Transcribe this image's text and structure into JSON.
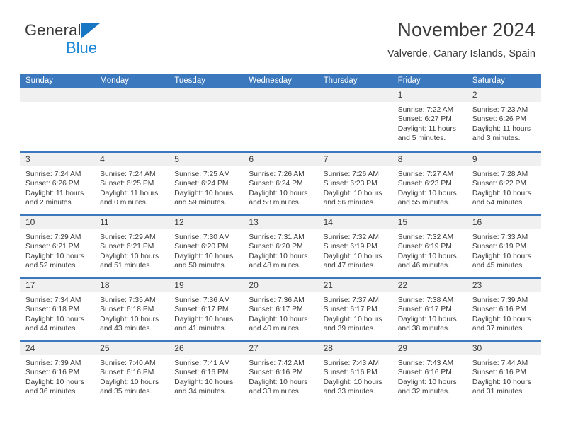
{
  "logo": {
    "word1": "General",
    "word2": "Blue",
    "triangle_icon": "triangle-icon"
  },
  "header": {
    "title": "November 2024",
    "subtitle": "Valverde, Canary Islands, Spain"
  },
  "colors": {
    "header_blue": "#3b78bd",
    "logo_blue": "#1d87d6",
    "daynum_band": "#f0f0f0",
    "text": "#3a3a3a"
  },
  "calendar": {
    "weekdays": [
      "Sunday",
      "Monday",
      "Tuesday",
      "Wednesday",
      "Thursday",
      "Friday",
      "Saturday"
    ],
    "weeks": [
      [
        {
          "day": "",
          "sunrise": "",
          "sunset": "",
          "daylight": ""
        },
        {
          "day": "",
          "sunrise": "",
          "sunset": "",
          "daylight": ""
        },
        {
          "day": "",
          "sunrise": "",
          "sunset": "",
          "daylight": ""
        },
        {
          "day": "",
          "sunrise": "",
          "sunset": "",
          "daylight": ""
        },
        {
          "day": "",
          "sunrise": "",
          "sunset": "",
          "daylight": ""
        },
        {
          "day": "1",
          "sunrise": "Sunrise: 7:22 AM",
          "sunset": "Sunset: 6:27 PM",
          "daylight": "Daylight: 11 hours and 5 minutes."
        },
        {
          "day": "2",
          "sunrise": "Sunrise: 7:23 AM",
          "sunset": "Sunset: 6:26 PM",
          "daylight": "Daylight: 11 hours and 3 minutes."
        }
      ],
      [
        {
          "day": "3",
          "sunrise": "Sunrise: 7:24 AM",
          "sunset": "Sunset: 6:26 PM",
          "daylight": "Daylight: 11 hours and 2 minutes."
        },
        {
          "day": "4",
          "sunrise": "Sunrise: 7:24 AM",
          "sunset": "Sunset: 6:25 PM",
          "daylight": "Daylight: 11 hours and 0 minutes."
        },
        {
          "day": "5",
          "sunrise": "Sunrise: 7:25 AM",
          "sunset": "Sunset: 6:24 PM",
          "daylight": "Daylight: 10 hours and 59 minutes."
        },
        {
          "day": "6",
          "sunrise": "Sunrise: 7:26 AM",
          "sunset": "Sunset: 6:24 PM",
          "daylight": "Daylight: 10 hours and 58 minutes."
        },
        {
          "day": "7",
          "sunrise": "Sunrise: 7:26 AM",
          "sunset": "Sunset: 6:23 PM",
          "daylight": "Daylight: 10 hours and 56 minutes."
        },
        {
          "day": "8",
          "sunrise": "Sunrise: 7:27 AM",
          "sunset": "Sunset: 6:23 PM",
          "daylight": "Daylight: 10 hours and 55 minutes."
        },
        {
          "day": "9",
          "sunrise": "Sunrise: 7:28 AM",
          "sunset": "Sunset: 6:22 PM",
          "daylight": "Daylight: 10 hours and 54 minutes."
        }
      ],
      [
        {
          "day": "10",
          "sunrise": "Sunrise: 7:29 AM",
          "sunset": "Sunset: 6:21 PM",
          "daylight": "Daylight: 10 hours and 52 minutes."
        },
        {
          "day": "11",
          "sunrise": "Sunrise: 7:29 AM",
          "sunset": "Sunset: 6:21 PM",
          "daylight": "Daylight: 10 hours and 51 minutes."
        },
        {
          "day": "12",
          "sunrise": "Sunrise: 7:30 AM",
          "sunset": "Sunset: 6:20 PM",
          "daylight": "Daylight: 10 hours and 50 minutes."
        },
        {
          "day": "13",
          "sunrise": "Sunrise: 7:31 AM",
          "sunset": "Sunset: 6:20 PM",
          "daylight": "Daylight: 10 hours and 48 minutes."
        },
        {
          "day": "14",
          "sunrise": "Sunrise: 7:32 AM",
          "sunset": "Sunset: 6:19 PM",
          "daylight": "Daylight: 10 hours and 47 minutes."
        },
        {
          "day": "15",
          "sunrise": "Sunrise: 7:32 AM",
          "sunset": "Sunset: 6:19 PM",
          "daylight": "Daylight: 10 hours and 46 minutes."
        },
        {
          "day": "16",
          "sunrise": "Sunrise: 7:33 AM",
          "sunset": "Sunset: 6:19 PM",
          "daylight": "Daylight: 10 hours and 45 minutes."
        }
      ],
      [
        {
          "day": "17",
          "sunrise": "Sunrise: 7:34 AM",
          "sunset": "Sunset: 6:18 PM",
          "daylight": "Daylight: 10 hours and 44 minutes."
        },
        {
          "day": "18",
          "sunrise": "Sunrise: 7:35 AM",
          "sunset": "Sunset: 6:18 PM",
          "daylight": "Daylight: 10 hours and 43 minutes."
        },
        {
          "day": "19",
          "sunrise": "Sunrise: 7:36 AM",
          "sunset": "Sunset: 6:17 PM",
          "daylight": "Daylight: 10 hours and 41 minutes."
        },
        {
          "day": "20",
          "sunrise": "Sunrise: 7:36 AM",
          "sunset": "Sunset: 6:17 PM",
          "daylight": "Daylight: 10 hours and 40 minutes."
        },
        {
          "day": "21",
          "sunrise": "Sunrise: 7:37 AM",
          "sunset": "Sunset: 6:17 PM",
          "daylight": "Daylight: 10 hours and 39 minutes."
        },
        {
          "day": "22",
          "sunrise": "Sunrise: 7:38 AM",
          "sunset": "Sunset: 6:17 PM",
          "daylight": "Daylight: 10 hours and 38 minutes."
        },
        {
          "day": "23",
          "sunrise": "Sunrise: 7:39 AM",
          "sunset": "Sunset: 6:16 PM",
          "daylight": "Daylight: 10 hours and 37 minutes."
        }
      ],
      [
        {
          "day": "24",
          "sunrise": "Sunrise: 7:39 AM",
          "sunset": "Sunset: 6:16 PM",
          "daylight": "Daylight: 10 hours and 36 minutes."
        },
        {
          "day": "25",
          "sunrise": "Sunrise: 7:40 AM",
          "sunset": "Sunset: 6:16 PM",
          "daylight": "Daylight: 10 hours and 35 minutes."
        },
        {
          "day": "26",
          "sunrise": "Sunrise: 7:41 AM",
          "sunset": "Sunset: 6:16 PM",
          "daylight": "Daylight: 10 hours and 34 minutes."
        },
        {
          "day": "27",
          "sunrise": "Sunrise: 7:42 AM",
          "sunset": "Sunset: 6:16 PM",
          "daylight": "Daylight: 10 hours and 33 minutes."
        },
        {
          "day": "28",
          "sunrise": "Sunrise: 7:43 AM",
          "sunset": "Sunset: 6:16 PM",
          "daylight": "Daylight: 10 hours and 33 minutes."
        },
        {
          "day": "29",
          "sunrise": "Sunrise: 7:43 AM",
          "sunset": "Sunset: 6:16 PM",
          "daylight": "Daylight: 10 hours and 32 minutes."
        },
        {
          "day": "30",
          "sunrise": "Sunrise: 7:44 AM",
          "sunset": "Sunset: 6:16 PM",
          "daylight": "Daylight: 10 hours and 31 minutes."
        }
      ]
    ]
  }
}
